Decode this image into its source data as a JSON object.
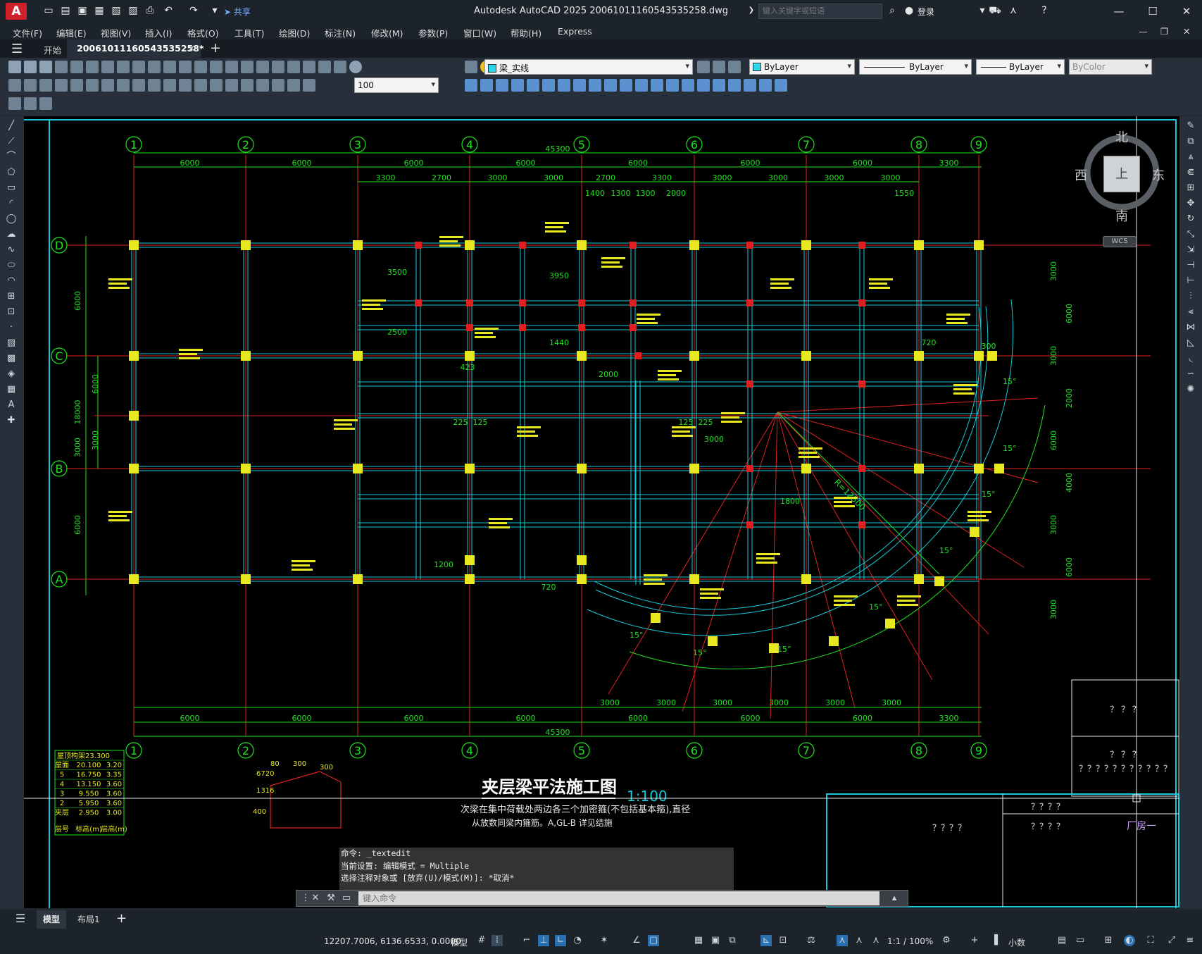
{
  "titlebar": {
    "app_logo": "A",
    "share_label": "共享",
    "title": "Autodesk AutoCAD 2025    20061011160543535258.dwg",
    "search_placeholder": "键入关键字或短语",
    "login_label": "登录"
  },
  "menu": [
    "文件(F)",
    "编辑(E)",
    "视图(V)",
    "插入(I)",
    "格式(O)",
    "工具(T)",
    "绘图(D)",
    "标注(N)",
    "修改(M)",
    "参数(P)",
    "窗口(W)",
    "帮助(H)",
    "Express"
  ],
  "tabs": {
    "start": "开始",
    "document": "20061011160543535258*",
    "add": "+"
  },
  "toolbar": {
    "layer_name": "梁_实线",
    "layer_color": "#2ad6e8",
    "color_value": "ByLayer",
    "linetype_value": "ByLayer",
    "lineweight_value": "ByLayer",
    "plotstyle_value": "ByColor",
    "scale_value": "100"
  },
  "viewcube": {
    "north": "北",
    "south": "南",
    "east": "东",
    "west": "西",
    "top": "上",
    "wcs": "WCS"
  },
  "drawing": {
    "grid_top": [
      "1",
      "2",
      "3",
      "4",
      "5",
      "6",
      "7",
      "8",
      "9"
    ],
    "grid_left": [
      "D",
      "C",
      "B",
      "A"
    ],
    "total_width": "45300",
    "top_dims": [
      "6000",
      "6000",
      "6000",
      "6000",
      "6000",
      "6000",
      "6000",
      "3300"
    ],
    "top_dims_2": [
      "3300",
      "2700",
      "3000",
      "3000",
      "2700",
      "3300",
      "3000",
      "3000",
      "3000",
      "3000"
    ],
    "top_dims_3": [
      "1400",
      "1300",
      "1300",
      "2000",
      "1550"
    ],
    "bottom_dims": [
      "6000",
      "6000",
      "6000",
      "6000",
      "6000",
      "6000",
      "6000",
      "3300"
    ],
    "bottom_dims_2": [
      "3000",
      "3000",
      "3000",
      "3000",
      "3000",
      "3000"
    ],
    "left_dims": [
      "6000",
      "18000",
      "6000",
      "6000",
      "3000",
      "3000"
    ],
    "right_dims": [
      "3000",
      "6000",
      "3000",
      "2000",
      "6000",
      "4000",
      "3000",
      "6000",
      "3000"
    ],
    "mid_dims": [
      "3500",
      "2500",
      "3950",
      "1440",
      "225",
      "125",
      "125",
      "225",
      "1800",
      "3000",
      "2000",
      "1200",
      "720",
      "720",
      "300",
      "423"
    ],
    "radius_label": "R=12500",
    "angle_label": "15°",
    "title_text": "夹层梁平法施工图",
    "scale_text": "1:100",
    "note_text": "次梁在集中荷载处两边各三个加密箍(不包括基本箍),直径",
    "note_text_2": "从放数同梁内箍筋。A,GL-B  详见结施",
    "level_table": {
      "header": "屋顶构架23.300",
      "rows": [
        [
          "屋面",
          "20.100",
          "3.20"
        ],
        [
          "5",
          "16.750",
          "3.35"
        ],
        [
          "4",
          "13.150",
          "3.60"
        ],
        [
          "3",
          "9.550",
          "3.60"
        ],
        [
          "2",
          "5.950",
          "3.60"
        ],
        [
          "夹层",
          "2.950",
          "3.00"
        ]
      ],
      "footer": [
        "层号",
        "标高(m)",
        "层高(m)"
      ]
    },
    "titleblock_q1": "？ ？ ？",
    "titleblock_q2": "？？？？？？？？？？？",
    "titleblock_q3": "？？？？",
    "titleblock_factory": "厂房一",
    "detail_dims": [
      "6720",
      "1316",
      "80",
      "300",
      "300",
      "400"
    ]
  },
  "command": {
    "history": [
      "命令: _textedit",
      "当前设置: 编辑模式 = Multiple",
      "选择注释对象或 [放弃(U)/模式(M)]: *取消*"
    ],
    "placeholder": "键入命令"
  },
  "layout_tabs": {
    "model": "模型",
    "layout1": "布局1",
    "add": "+"
  },
  "status": {
    "coords": "12207.7006, 6136.6533, 0.0000",
    "model_label": "模型",
    "scale": "1:1 / 100%",
    "units": "小数"
  }
}
